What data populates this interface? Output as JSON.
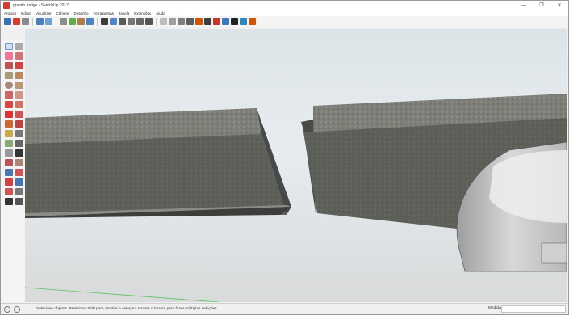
{
  "window": {
    "title": "granito antigo - SketchUp 2017",
    "controls": [
      "—",
      "❐",
      "✕"
    ]
  },
  "menu": {
    "items": [
      "Arquivo",
      "Editar",
      "Visualizar",
      "Câmera",
      "Desenho",
      "Ferramentas",
      "Janela",
      "Extensões",
      "Ajuda"
    ]
  },
  "status": {
    "hint": "Selecione objetos. Pressione Shift para ampliar a seleção. Arraste o mouse para fazer múltiplas seleções.",
    "measure_label": "Medidas",
    "measure_value": ""
  },
  "colors": {
    "accent": "#d33b2c",
    "sky": "#e3eaee",
    "ground": "#d5d7d8",
    "granite_top": "#8e8f87",
    "granite_side": "#5f615b",
    "sink": "#c8c8c8"
  },
  "icons": {
    "toolbar": [
      "new-icon",
      "open-icon",
      "save-icon",
      "cut-icon",
      "copy-icon",
      "paste-icon",
      "erase-icon",
      "undo-icon",
      "redo-icon",
      "print-icon",
      "model-info-icon",
      "iso-view-icon",
      "top-view-icon",
      "front-view-icon",
      "right-view-icon",
      "back-view-icon",
      "left-view-icon",
      "xray-icon",
      "wireframe-icon",
      "hidden-line-icon",
      "shaded-icon",
      "textured-icon",
      "monochrome-icon",
      "warehouse-icon",
      "extension-warehouse-icon",
      "layout-icon",
      "share-icon",
      "ruby-icon"
    ],
    "left_toolbar": [
      "select-icon",
      "component-icon",
      "eraser-icon",
      "paint-icon",
      "line-icon",
      "freehand-icon",
      "rectangle-icon",
      "rotated-rect-icon",
      "circle-icon",
      "polygon-icon",
      "arc-icon",
      "pie-icon",
      "move-icon",
      "push-pull-icon",
      "rotate-icon",
      "follow-me-icon",
      "scale-icon",
      "offset-icon",
      "tape-icon",
      "dimension-icon",
      "protractor-icon",
      "text-icon",
      "axes-icon",
      "3d-text-icon",
      "orbit-icon",
      "pan-icon",
      "zoom-icon",
      "zoom-window-icon",
      "zoom-extents-icon",
      "previous-icon",
      "position-camera-icon",
      "look-around-icon",
      "walk-icon",
      "section-icon"
    ]
  }
}
